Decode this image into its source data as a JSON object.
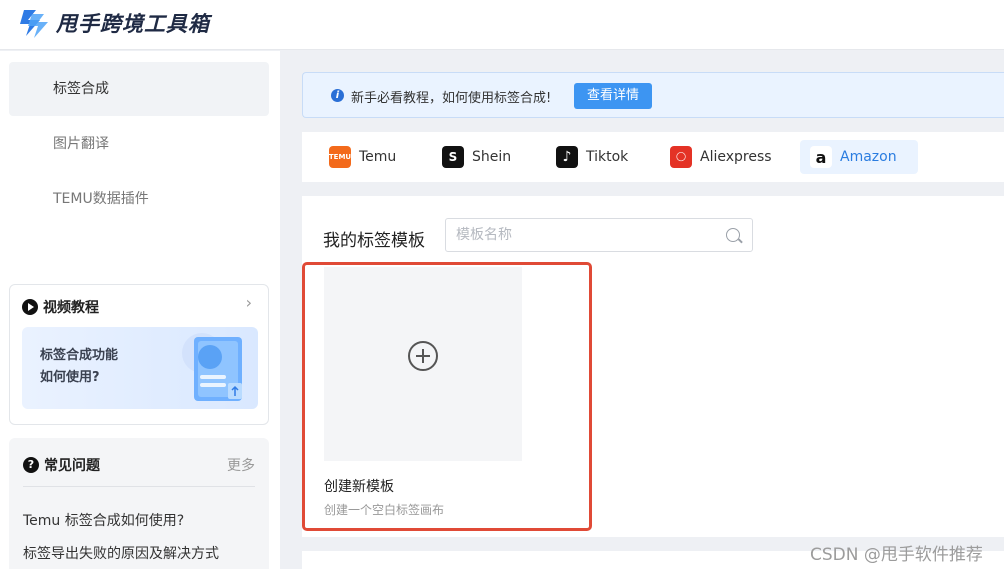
{
  "app": {
    "name": "甩手跨境工具箱"
  },
  "sidebar": {
    "items": [
      {
        "label": "标签合成"
      },
      {
        "label": "图片翻译"
      },
      {
        "label": "TEMU数据插件"
      }
    ]
  },
  "video_card": {
    "title": "视频教程",
    "banner_line1": "标签合成功能",
    "banner_line2": "如何使用?"
  },
  "faq": {
    "title": "常见问题",
    "more": "更多",
    "questions": [
      "Temu 标签合成如何使用?",
      "标签导出失败的原因及解决方式"
    ]
  },
  "notice": {
    "text": "新手必看教程，如何使用标签合成!",
    "button": "查看详情"
  },
  "platforms": [
    {
      "label": "Temu",
      "icon": "temu-icon",
      "color": "#f36a1b"
    },
    {
      "label": "Shein",
      "icon": "shein-icon",
      "color": "#111111"
    },
    {
      "label": "Tiktok",
      "icon": "tiktok-icon",
      "color": "#111111"
    },
    {
      "label": "Aliexpress",
      "icon": "aliexpress-icon",
      "color": "#e43225"
    },
    {
      "label": "Amazon",
      "icon": "amazon-icon",
      "color": "#ff9900",
      "active": true
    }
  ],
  "templates": {
    "title": "我的标签模板",
    "search_placeholder": "模板名称",
    "new_template": {
      "name": "创建新模板",
      "desc": "创建一个空白标签画布"
    }
  },
  "watermark": "CSDN @甩手软件推荐",
  "colors": {
    "accent": "#3d95f2",
    "highlight_border": "#e04a36"
  }
}
